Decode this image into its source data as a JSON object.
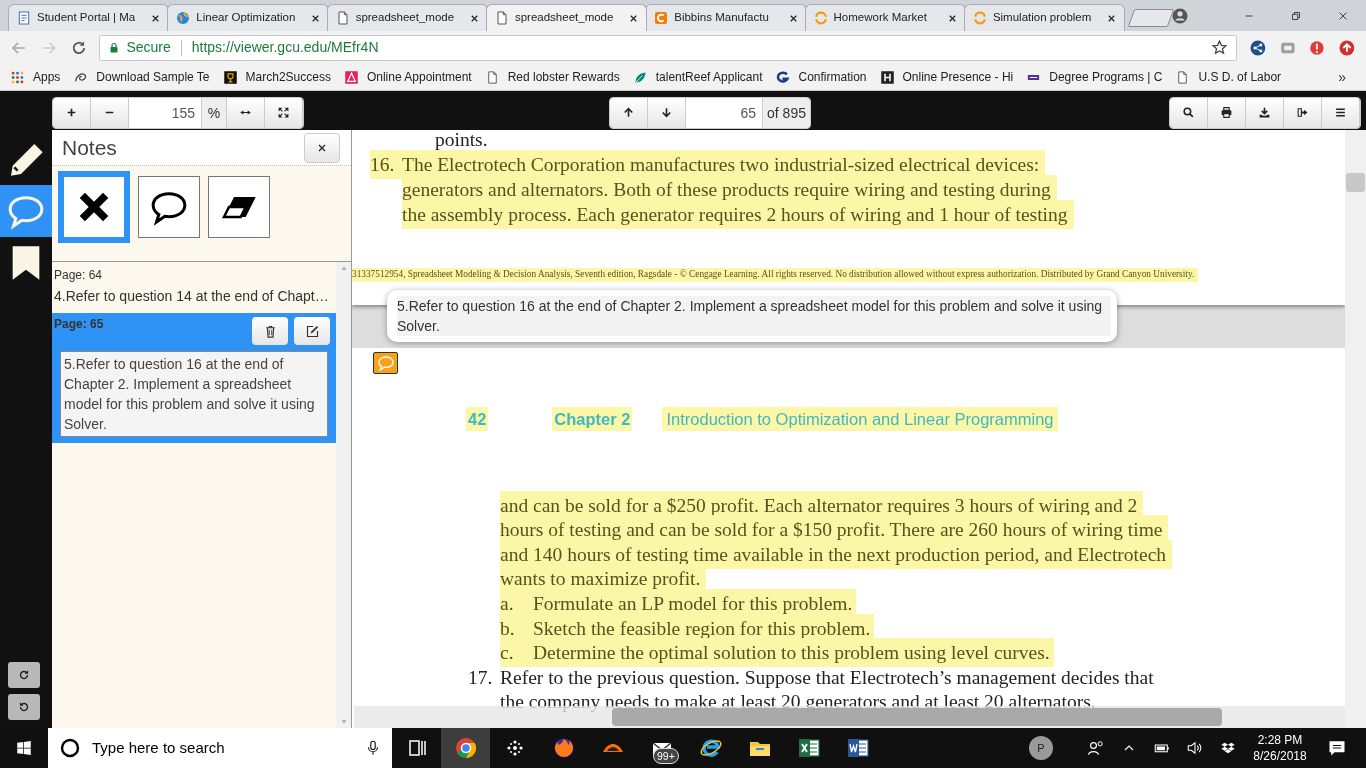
{
  "browser": {
    "tabs": [
      {
        "kind": "page-blue",
        "title": "Student Portal | Ma",
        "selected": false
      },
      {
        "kind": "globe",
        "title": "Linear Optimization",
        "selected": false
      },
      {
        "kind": "page",
        "title": "spreadsheet_mode",
        "selected": false
      },
      {
        "kind": "page",
        "title": "spreadsheet_mode",
        "selected": true
      },
      {
        "kind": "c-logo",
        "title": "Bibbins Manufactu",
        "selected": false
      },
      {
        "kind": "arcs",
        "title": "Homework Market",
        "selected": false
      },
      {
        "kind": "arcs",
        "title": "Simulation problem",
        "selected": false
      }
    ],
    "address": {
      "secure_label": "Secure",
      "url": "https://viewer.gcu.edu/MEfr4N"
    },
    "bookmarks": [
      {
        "kind": "grid",
        "label": "Apps"
      },
      {
        "kind": "swirl",
        "label": "Download Sample Te"
      },
      {
        "kind": "trophy",
        "label": "March2Success"
      },
      {
        "kind": "triangle",
        "label": "Online Appointment"
      },
      {
        "kind": "page",
        "label": "Red lobster Rewards"
      },
      {
        "kind": "leaf",
        "label": "talentReef Applicant"
      },
      {
        "kind": "g-logo",
        "label": "Confirmation"
      },
      {
        "kind": "h-logo",
        "label": "Online Presence - Hi"
      },
      {
        "kind": "gcu",
        "label": "Degree Programs | C"
      },
      {
        "kind": "page",
        "label": "U.S D. of Labor"
      }
    ],
    "more": "»"
  },
  "viewer_toolbar": {
    "zoom": "155",
    "zoom_unit": "%",
    "page": "65",
    "page_count": "of 895"
  },
  "rail": [
    {
      "kind": "pencil",
      "selected": false
    },
    {
      "kind": "comment",
      "selected": true
    },
    {
      "kind": "bookmark",
      "selected": false
    }
  ],
  "notes": {
    "title": "Notes",
    "tools": [
      {
        "kind": "cross",
        "selected": true
      },
      {
        "kind": "comment",
        "selected": false
      },
      {
        "kind": "eraser",
        "selected": false
      }
    ],
    "items": [
      {
        "page": "Page: 64",
        "text": "4.Refer to question 14 at the end of Chapt…",
        "selected": false
      },
      {
        "page": "Page: 65",
        "text": "5.Refer to question 16 at the end of Chapter 2. Implement a spreadsheet model for this problem and solve it using Solver.",
        "selected": true
      }
    ]
  },
  "document": {
    "page_top": {
      "lines": [
        {
          "kind": "sub",
          "text": "points.",
          "highlighted": false
        },
        {
          "kind": "question",
          "label": "16.",
          "text": "The Electrotech Corporation manufactures two industrial-sized electrical devices:",
          "highlighted": true
        },
        {
          "kind": "continuation",
          "text": "generators and alternators. Both of these products require wiring and testing during",
          "highlighted": true
        },
        {
          "kind": "continuation",
          "text": "the assembly process. Each generator requires 2 hours of wiring and 1 hour of testing",
          "highlighted": true
        }
      ],
      "footer": "31337512954, Spreadsheet Modeling & Decision Analysis, Seventh edition, Ragsdale - © Cengage Learning. All rights reserved. No distribution allowed without express authorization. Distributed by Grand Canyon University."
    },
    "tooltip": "5.Refer to question 16 at the end of Chapter 2. Implement a spreadsheet model for this problem and solve it using Solver.",
    "page_next": {
      "page_number": "42",
      "chapter": "Chapter 2",
      "chapter_title": "Introduction to Optimization and Linear Programming",
      "lines": [
        {
          "kind": "continuation",
          "text": "and can be sold for a $250 profit. Each alternator requires 3 hours of wiring and 2",
          "highlighted": true
        },
        {
          "kind": "continuation",
          "text": "hours of testing and can be sold for a $150 profit. There are 260 hours of wiring time",
          "highlighted": true
        },
        {
          "kind": "continuation",
          "text": "and 140 hours of testing time available in the next production period, and Electrotech",
          "highlighted": true
        },
        {
          "kind": "continuation",
          "text": "wants to maximize profit.",
          "highlighted": true
        },
        {
          "kind": "sub",
          "label": "a.",
          "text": "Formulate an LP model for this problem.",
          "highlighted": true
        },
        {
          "kind": "sub",
          "label": "b.",
          "text": "Sketch the feasible region for this problem.",
          "highlighted": true
        },
        {
          "kind": "sub",
          "label": "c.",
          "text": "Determine the optimal solution to this problem using level curves.",
          "highlighted": true
        },
        {
          "kind": "question",
          "label": "17.",
          "text": "Refer to the previous question. Suppose that Electrotech’s management decides that",
          "highlighted": false
        },
        {
          "kind": "continuation",
          "text": "the company needs to make at least 20 generators and at least 20 alternators.",
          "highlighted": false
        }
      ]
    }
  },
  "taskbar": {
    "search_placeholder": "Type here to search",
    "apps": [
      {
        "kind": "taskview",
        "active": false
      },
      {
        "kind": "chrome",
        "active": true
      },
      {
        "kind": "dots",
        "active": false
      },
      {
        "kind": "firefox",
        "active": false
      },
      {
        "kind": "flame",
        "active": false
      },
      {
        "kind": "mail",
        "active": false,
        "badge": "99+"
      },
      {
        "kind": "ie",
        "active": false
      },
      {
        "kind": "folder",
        "active": false
      },
      {
        "kind": "excel",
        "active": false
      },
      {
        "kind": "word",
        "active": false
      }
    ],
    "avatar": "P",
    "time": "2:28 PM",
    "date": "8/26/2018"
  }
}
